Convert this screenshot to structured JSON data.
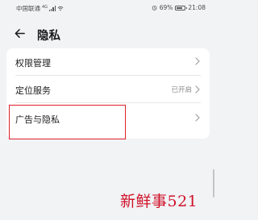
{
  "status_bar": {
    "carrier": "中国联通",
    "network": "4G",
    "battery": "69%",
    "battery_level": 0.69,
    "time": "21:08"
  },
  "header": {
    "title": "隐私"
  },
  "settings": {
    "items": [
      {
        "label": "权限管理",
        "value": ""
      },
      {
        "label": "定位服务",
        "value": "已开启"
      },
      {
        "label": "广告与隐私",
        "value": ""
      }
    ]
  },
  "watermark": {
    "text": "新鲜事521"
  },
  "colors": {
    "background": "#f1f3f5",
    "card": "#ffffff",
    "highlight_box": "#e0202a",
    "watermark": "#d0122a",
    "secondary_text": "#8a8a8a"
  },
  "icons": {
    "back": "arrow-left-icon",
    "chevron": "chevron-right-icon",
    "wifi": "wifi-icon",
    "signal": "signal-icon",
    "alarm": "alarm-icon",
    "battery": "battery-icon"
  }
}
